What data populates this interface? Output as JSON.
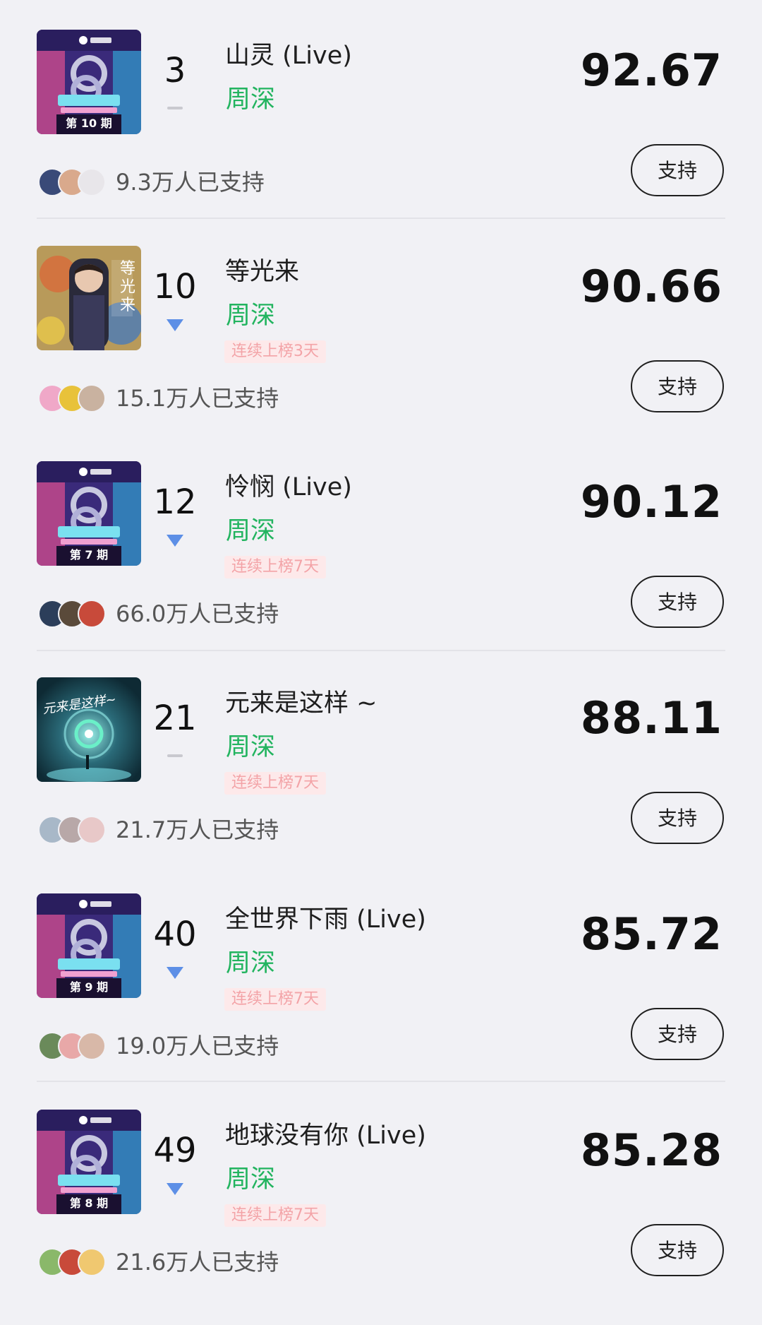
{
  "entries": [
    {
      "cover": "cover-show-ep10",
      "cover_label": "第 10 期",
      "rank": "3",
      "trend": "flat",
      "title": "山灵 (Live)",
      "artist": "周深",
      "streak": "",
      "score": "92.67",
      "supporters": "9.3万人已支持",
      "button_label": "支持",
      "avatar_colors": [
        "#3a4a78",
        "#d9a98c",
        "#e8e6ea"
      ]
    },
    {
      "cover": "cover-album-waiting-light",
      "cover_label": "等光来",
      "rank": "10",
      "trend": "down",
      "title": "等光来",
      "artist": "周深",
      "streak": "连续上榜3天",
      "score": "90.66",
      "supporters": "15.1万人已支持",
      "button_label": "支持",
      "avatar_colors": [
        "#f0a8c8",
        "#e8c23a",
        "#c9b2a0"
      ]
    },
    {
      "cover": "cover-show-ep7",
      "cover_label": "第 7 期",
      "rank": "12",
      "trend": "down",
      "title": "怜悯 (Live)",
      "artist": "周深",
      "streak": "连续上榜7天",
      "score": "90.12",
      "supporters": "66.0万人已支持",
      "button_label": "支持",
      "avatar_colors": [
        "#2c3e5a",
        "#5a4a3a",
        "#c84a3a"
      ]
    },
    {
      "cover": "cover-single-yuanlai",
      "cover_label": "元来是这样~",
      "rank": "21",
      "trend": "flat",
      "title": "元来是这样 ~",
      "artist": "周深",
      "streak": "连续上榜7天",
      "score": "88.11",
      "supporters": "21.7万人已支持",
      "button_label": "支持",
      "avatar_colors": [
        "#a8b8c8",
        "#b8a8a8",
        "#e8c8c8"
      ]
    },
    {
      "cover": "cover-show-ep9",
      "cover_label": "第 9 期",
      "rank": "40",
      "trend": "down",
      "title": "全世界下雨 (Live)",
      "artist": "周深",
      "streak": "连续上榜7天",
      "score": "85.72",
      "supporters": "19.0万人已支持",
      "button_label": "支持",
      "avatar_colors": [
        "#6a8a5a",
        "#e8a8a8",
        "#d8b8a8"
      ]
    },
    {
      "cover": "cover-show-ep8",
      "cover_label": "第 8 期",
      "rank": "49",
      "trend": "down",
      "title": "地球没有你 (Live)",
      "artist": "周深",
      "streak": "连续上榜7天",
      "score": "85.28",
      "supporters": "21.6万人已支持",
      "button_label": "支持",
      "avatar_colors": [
        "#8ab86a",
        "#c84a3a",
        "#f0c870"
      ]
    }
  ],
  "colors": {
    "artist": "#22b45f",
    "trend_down": "#5d8fe6",
    "trend_flat": "#c9c9cf",
    "streak_bg": "#fde9ea",
    "streak_text": "#f3a3a7",
    "background": "#f1f1f5"
  }
}
